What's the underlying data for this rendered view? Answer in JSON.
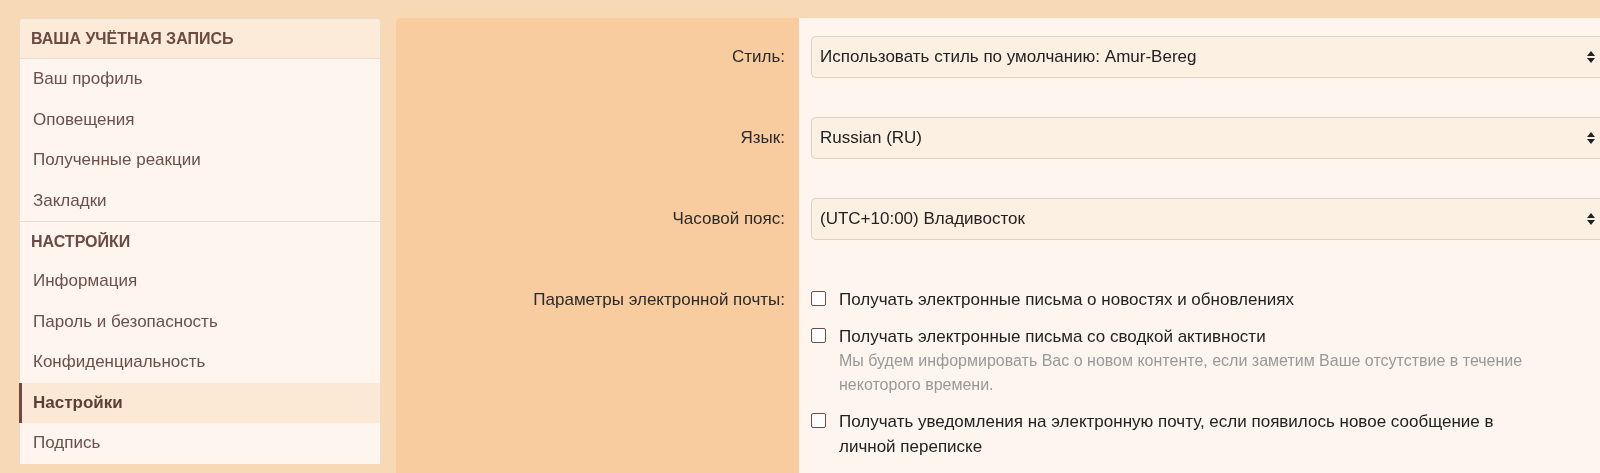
{
  "sidebar": {
    "sections": [
      {
        "title": "ВАША УЧЁТНАЯ ЗАПИСЬ",
        "items": [
          {
            "label": "Ваш профиль",
            "selected": false
          },
          {
            "label": "Оповещения",
            "selected": false
          },
          {
            "label": "Полученные реакции",
            "selected": false
          },
          {
            "label": "Закладки",
            "selected": false
          }
        ]
      },
      {
        "title": "НАСТРОЙКИ",
        "items": [
          {
            "label": "Информация",
            "selected": false
          },
          {
            "label": "Пароль и безопасность",
            "selected": false
          },
          {
            "label": "Конфиденциальность",
            "selected": false
          },
          {
            "label": "Настройки",
            "selected": true
          },
          {
            "label": "Подпись",
            "selected": false
          }
        ]
      }
    ]
  },
  "form": {
    "fields": [
      {
        "kind": "select",
        "label": "Стиль:",
        "value": "Использовать стиль по умолчанию: Amur-Bereg"
      },
      {
        "kind": "select",
        "label": "Язык:",
        "value": "Russian (RU)"
      },
      {
        "kind": "select",
        "label": "Часовой пояс:",
        "value": "(UTC+10:00) Владивосток"
      },
      {
        "kind": "checkboxes",
        "label": "Параметры электронной почты:",
        "options": [
          {
            "label": "Получать электронные письма о новостях и обновлениях",
            "checked": false
          },
          {
            "label": "Получать электронные письма со сводкой активности",
            "checked": false,
            "hint": "Мы будем информировать Вас о новом контенте, если заметим Ваше отсутствие в течение некоторого времени."
          },
          {
            "label": "Получать уведомления на электронную почту, если появилось новое сообщение в личной переписке",
            "checked": false
          }
        ]
      }
    ]
  }
}
